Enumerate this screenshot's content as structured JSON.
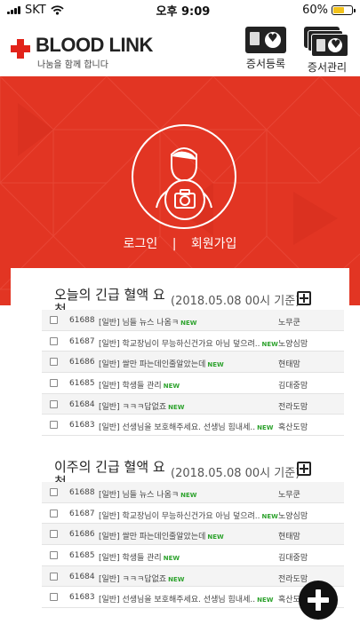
{
  "status_bar": {
    "carrier": "SKT",
    "time": "오후 9:09",
    "battery": "60%",
    "battery_level": 0.6
  },
  "header": {
    "logo_text": "BLOOD LINK",
    "logo_sub": "나눔을 함께 합니다",
    "cert_register": "증서등록",
    "cert_manage": "증서관리",
    "brand_color": "#e2231a"
  },
  "hero": {
    "login": "로그인",
    "separator": "|",
    "signup": "회원가입",
    "bg_color": "#e23523"
  },
  "sections": [
    {
      "title": "오늘의 긴급 혈액 요청",
      "date": "(2018.05.08 00시 기준)",
      "rows": [
        {
          "num": "61688",
          "title": "[일반] 님들 뉴스 나옴ㅋ",
          "new": "NEW",
          "author": "노무쿤"
        },
        {
          "num": "61687",
          "title": "[일반] 학교장님이 무능하신건가요 아님 덮으려..",
          "new": "NEW",
          "author": "노양심맘"
        },
        {
          "num": "61686",
          "title": "[일반] 쌀만 파는데인줄알았는데",
          "new": "NEW",
          "author": "현태맘"
        },
        {
          "num": "61685",
          "title": "[일반] 학생들 관리",
          "new": "NEW",
          "author": "김대중맘"
        },
        {
          "num": "61684",
          "title": "[일반] ㅋㅋㅋ답없죠",
          "new": "NEW",
          "author": "전라도맘"
        },
        {
          "num": "61683",
          "title": "[일반] 선생님을 보호해주세요. 선생님 힘내세..",
          "new": "NEW",
          "author": "혹산도맘"
        }
      ]
    },
    {
      "title": "이주의 긴급 혈액 요청",
      "date": "(2018.05.08 00시 기준)",
      "rows": [
        {
          "num": "61688",
          "title": "[일반] 님들 뉴스 나옴ㅋ",
          "new": "NEW",
          "author": "노무쿤"
        },
        {
          "num": "61687",
          "title": "[일반] 학교장님이 무능하신건가요 아님 덮으려..",
          "new": "NEW",
          "author": "노양심맘"
        },
        {
          "num": "61686",
          "title": "[일반] 쌀만 파는데인줄알았는데",
          "new": "NEW",
          "author": "현태맘"
        },
        {
          "num": "61685",
          "title": "[일반] 학생들 관리",
          "new": "NEW",
          "author": "김대중맘"
        },
        {
          "num": "61684",
          "title": "[일반] ㅋㅋㅋ답없죠",
          "new": "NEW",
          "author": "전라도맘"
        },
        {
          "num": "61683",
          "title": "[일반] 선생님을 보호해주세요. 선생님 힘내세..",
          "new": "NEW",
          "author": "혹산도맘"
        }
      ]
    }
  ],
  "icons": [
    "wifi-icon",
    "signal-icon",
    "battery-icon",
    "blood-cross-icon",
    "certificate-card-icon",
    "certificate-stack-icon",
    "profile-avatar-icon",
    "camera-icon",
    "plus-box-icon",
    "plus-fab-icon"
  ]
}
